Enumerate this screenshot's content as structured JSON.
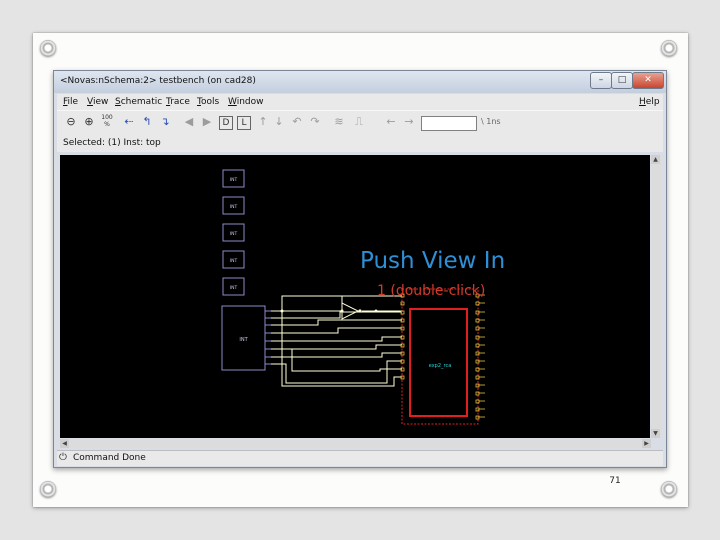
{
  "window": {
    "title": "<Novas:nSchema:2> testbench (on cad28)",
    "controls": {
      "minimize": "–",
      "maximize": "□",
      "close": "✕"
    }
  },
  "menubar": {
    "items": [
      "File",
      "View",
      "Schematic",
      "Trace",
      "Tools",
      "Window"
    ],
    "help": "Help"
  },
  "toolbar": {
    "zoom_label": "100",
    "zoom_unit": "%",
    "search_value": "",
    "unit_label": "\\ 1ns",
    "icons": [
      "zoom-out-icon",
      "zoom-in-icon",
      "zoom-fit-icon",
      "trace-driver-icon",
      "trace-load-icon",
      "trace-connectivity-icon",
      "push-in-icon",
      "pop-out-icon",
      "d-icon",
      "l-icon",
      "move-up-icon",
      "move-down-icon",
      "undo-icon",
      "redo-icon",
      "signal-icon",
      "waveform-icon",
      "back-icon",
      "forward-icon"
    ]
  },
  "status": {
    "selected": "Selected: (1) Inst: top"
  },
  "schematic": {
    "small_blocks": [
      "INT",
      "INT",
      "INT",
      "INT",
      "INT"
    ],
    "big_block": "INT",
    "module": "exp2_rca"
  },
  "command_bar": {
    "text": "Command Done"
  },
  "annotation": {
    "title": "Push View In",
    "subtitle": "1 (double-click)"
  },
  "slide": {
    "page_number": "71"
  },
  "colors": {
    "annotation_title": "#2f8fd6",
    "annotation_subtitle": "#d43a2a",
    "wire": "#ffffd8",
    "block_outline": "#8c8cc8",
    "module_outline": "#e02020",
    "module_label": "#2fd3d3",
    "canvas_bg": "#000000"
  }
}
